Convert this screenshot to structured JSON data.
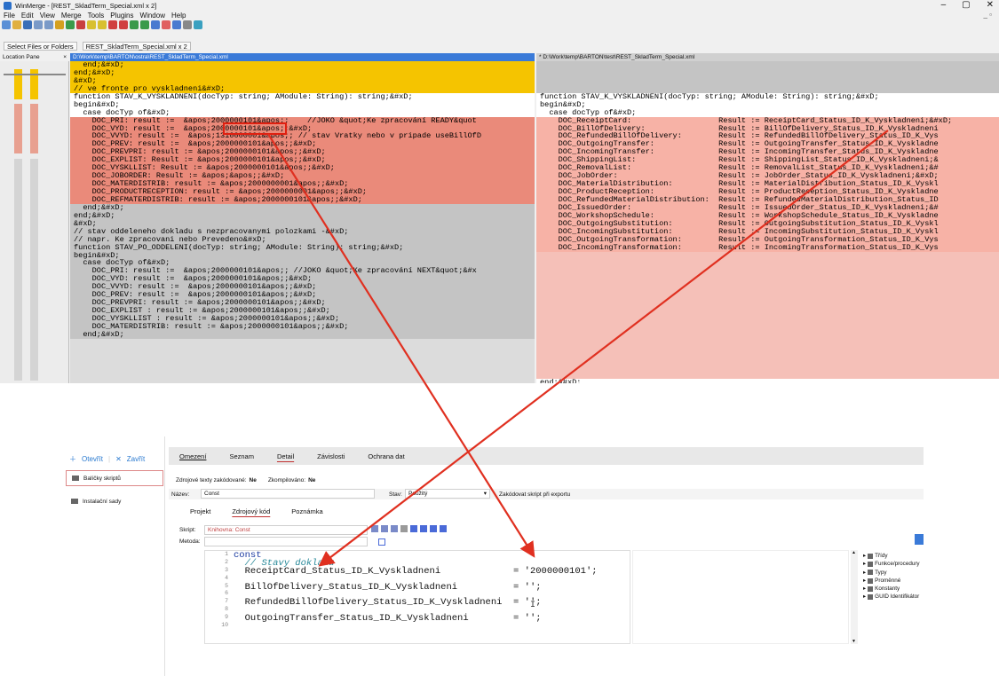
{
  "winmerge": {
    "title": "WinMerge - [REST_SkladTerm_Special.xml x 2]",
    "menu": [
      "File",
      "Edit",
      "View",
      "Merge",
      "Tools",
      "Plugins",
      "Window",
      "Help"
    ],
    "tabs": [
      "Select Files or Folders",
      "REST_SkladTerm_Special.xml x 2"
    ],
    "location_pane": "Location Pane",
    "left_path": "D:\\Work\\temp\\BARTON\\ostra\\REST_SkladTerm_Special.xml",
    "right_path": "* D:\\Work\\temp\\BARTON\\test\\REST_SkladTerm_Special.xml",
    "left_lines": [
      "  end;&#xD;",
      "end;&#xD;",
      "&#xD;",
      "// ve fronte pro vyskladneni&#xD;",
      "function STAV_K_VYSKLADNENI(docTyp: string; AModule: String): string;&#xD;",
      "begin&#xD;",
      "  case docTyp of&#xD;",
      "    DOC_PRI: result :=  &apos;2000000101&apos;;    //JOKO &quot;Ke zpracování READY&quot",
      "    DOC_VYD: result :=  &apos;2000000101&apos;;&#xD;",
      "    DOC_VVYD: result :=  &apos;1310000001&apos;; // stav Vratky nebo v pripade useBillOfD",
      "    DOC_PREV: result :=  &apos;2000000101&apos;;&#xD;",
      "    DOC_PREVPRI: result := &apos;2000000101&apos;;&#xD;",
      "    DOC_EXPLIST: Result := &apos;2000000101&apos;;&#xD;",
      "    DOC_VYSKLLIST: Result := &apos;2000000101&apos;;&#xD;",
      "    DOC_JOBORDER: Result := &apos;&apos;;&#xD;",
      "    DOC_MATERDISTRIB: result := &apos;2000000001&apos;;&#xD;",
      "    DOC_PRODUCTRECEPTION: result := &apos;2000000001&apos;;&#xD;",
      "    DOC_REFMATERDISTRIB: result := &apos;2000000101&apos;;&#xD;",
      "  end;&#xD;",
      "end;&#xD;",
      "&#xD;",
      "// stav oddeleneho dokladu s nezpracovanymi polozkami -&#xD;",
      "// napr. Ke zpracovani nebo Prevedeno&#xD;",
      "function STAV_PO_ODDELENI(docTyp: string; AModule: String): string;&#xD;",
      "begin&#xD;",
      "  case docTyp of&#xD;",
      "    DOC_PRI: result :=  &apos;2000000101&apos;; //JOKO &quot;Ke zpracování NEXT&quot;&#x",
      "    DOC_VYD: result :=  &apos;2000000101&apos;;&#xD;",
      "    DOC_VVYD: result :=  &apos;2000000101&apos;;&#xD;",
      "    DOC_PREV: result :=  &apos;2000000101&apos;;&#xD;",
      "    DOC_PREVPRI: result := &apos;2000000101&apos;;&#xD;",
      "    DOC_EXPLIST : result := &apos;2000000101&apos;;&#xD;",
      "    DOC_VYSKLLIST : result := &apos;2000000101&apos;;&#xD;",
      "    DOC_MATERDISTRIB: result := &apos;2000000101&apos;;&#xD;",
      "  end;&#xD;"
    ],
    "right_lines": [
      "",
      "",
      "",
      "",
      "function STAV_K_VYSKLADNENI(docTyp: string; AModule: String): string;&#xD;",
      "begin&#xD;",
      "  case docTyp of&#xD;",
      "    DOC_ReceiptCard:                   Result := ReceiptCard_Status_ID_K_Vyskladneni;&#xD;",
      "    DOC_BillOfDelivery:                Result := BillOfDelivery_Status_ID_K_Vyskladneni",
      "    DOC_RefundedBillOfDelivery:        Result := RefundedBillOfDelivery_Status_ID_K_Vys",
      "    DOC_OutgoingTransfer:              Result := OutgoingTransfer_Status_ID_K_Vyskladne",
      "    DOC_IncomingTransfer:              Result := IncomingTransfer_Status_ID_K_Vyskladne",
      "    DOC_ShippingList:                  Result := ShippingList_Status_ID_K_Vyskladneni;&",
      "    DOC_RemovalList:                   Result := RemovalList_Status_ID_K_Vyskladneni;&#",
      "    DOC_JobOrder:                      Result := JobOrder_Status_ID_K_Vyskladneni;&#xD;",
      "    DOC_MaterialDistribution:          Result := MaterialDistribution_Status_ID_K_Vyskl",
      "    DOC_ProductReception:              Result := ProductReception_Status_ID_K_Vyskladne",
      "    DOC_RefundedMaterialDistribution:  Result := RefundedMaterialDistribution_Status_ID",
      "    DOC_IssuedOrder:                   Result := IssuedOrder_Status_ID_K_Vyskladneni;&#",
      "    DOC_WorkshopSchedule:              Result := WorkshopSchedule_Status_ID_K_Vyskladne",
      "    DOC_OutgoingSubstitution:          Result := OutgoingSubstitution_Status_ID_K_Vyskl",
      "    DOC_IncomingSubstitution:          Result := IncomingSubstitution_Status_ID_K_Vyskl",
      "    DOC_OutgoingTransformation:        Result := OutgoingTransformation_Status_ID_K_Vys",
      "    DOC_IncomingTransformation:        Result := IncomingTransformation_Status_ID_K_Vys",
      "",
      "",
      "",
      "",
      "",
      "",
      "",
      "",
      "",
      "",
      "",
      "",
      "",
      "",
      "",
      "",
      "end;&#xD;"
    ]
  },
  "k2": {
    "open": "Otevřít",
    "close": "Zavřít",
    "nav": [
      "Balíčky skriptů",
      "Instalační sady"
    ],
    "tabs": [
      "Omezení",
      "Seznam",
      "Detail",
      "Závislosti",
      "Ochrana dat"
    ],
    "info_encoded": "Zdrojové texty zakódované:",
    "info_encoded_val": "Ne",
    "info_compiled": "Zkompilováno:",
    "info_compiled_val": "Ne",
    "name_label": "Název:",
    "name_value": "Const",
    "state_label": "Stav:",
    "state_value": "Použitý",
    "encode_label": "Zakódovat skript při exportu",
    "subtabs": [
      "Projekt",
      "Zdrojový kód",
      "Poznámka"
    ],
    "script_label": "Skript:",
    "script_value": "Knihovna: Const",
    "method_label": "Metoda:",
    "line_numbers": [
      "1",
      "2",
      "3",
      "4",
      "5",
      "6",
      "7",
      "8",
      "9",
      "10"
    ],
    "code": [
      {
        "n": 1,
        "t": "const"
      },
      {
        "n": 2,
        "t": "  // Stavy dokladu"
      },
      {
        "n": 3,
        "t": "  ReceiptCard_Status_ID_K_Vyskladneni             = '2000000101';"
      },
      {
        "n": 5,
        "t": "  BillOfDelivery_Status_ID_K_Vyskladneni          = '';"
      },
      {
        "n": 7,
        "t": "  RefundedBillOfDelivery_Status_ID_K_Vyskladneni  = '';"
      },
      {
        "n": 9,
        "t": "  OutgoingTransfer_Status_ID_K_Vyskladneni        = '';"
      }
    ],
    "tree": [
      "Třídy",
      "Funkce/procedury",
      "Typy",
      "Proměnné",
      "Konstanty",
      "GUID Identifikátor"
    ]
  }
}
